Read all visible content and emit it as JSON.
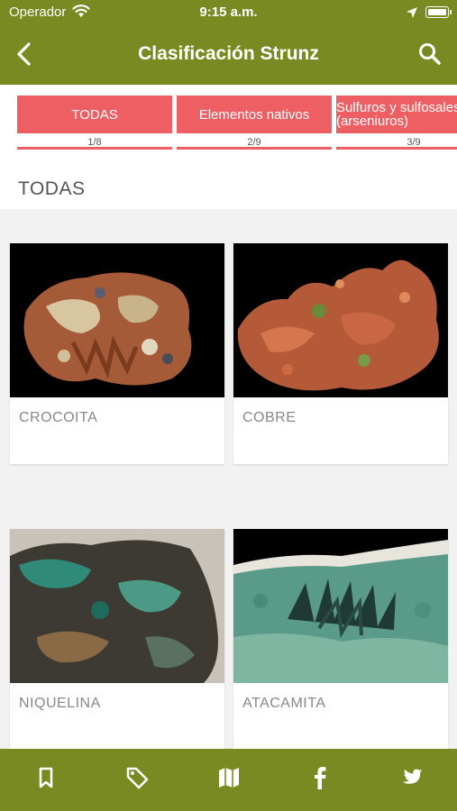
{
  "status_bar": {
    "carrier": "Operador",
    "time": "9:15 a.m.",
    "icons": [
      "wifi-icon",
      "location-arrow-icon",
      "battery-icon"
    ]
  },
  "nav": {
    "title": "Clasificación Strunz",
    "back_icon": "chevron-left-icon",
    "search_icon": "search-icon",
    "bar_color": "#7a8a22"
  },
  "tabs": [
    {
      "label": "TODAS",
      "count": "1/8"
    },
    {
      "label": "Elementos nativos",
      "count": "2/9"
    },
    {
      "label": "Sulfuros y sulfosales (arseniuros)",
      "count": "3/9"
    }
  ],
  "accent_color": "#ee5f63",
  "section": {
    "title": "TODAS"
  },
  "minerals": [
    {
      "name": "CROCOITA"
    },
    {
      "name": "COBRE"
    },
    {
      "name": "NIQUELINA"
    },
    {
      "name": "ATACAMITA"
    }
  ],
  "bottom_nav": {
    "items": [
      "bookmark-icon",
      "tag-icon",
      "map-icon",
      "facebook-icon",
      "twitter-icon"
    ]
  }
}
